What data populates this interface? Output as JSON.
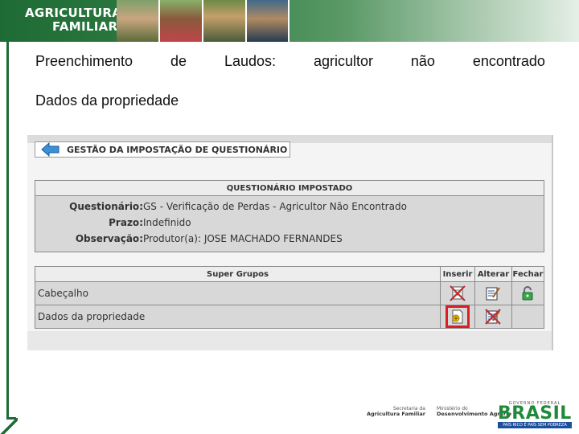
{
  "banner": {
    "title_line1": "AGRICULTURA",
    "title_line2": "FAMILIAR"
  },
  "slide": {
    "heading_words": [
      "Preenchimento",
      "de",
      "Laudos:",
      "agricultor",
      "não",
      "encontrado"
    ],
    "subheading": "Dados da propriedade"
  },
  "screen": {
    "section_title": "GESTÃO DA IMPOSTAÇÃO DE QUESTIONÁRIO",
    "questionnaire": {
      "header": "QUESTIONÁRIO IMPOSTADO",
      "fields": [
        {
          "label": "Questionário",
          "value": "GS - Verificação de Perdas - Agricultor Não Encontrado"
        },
        {
          "label": "Prazo",
          "value": "Indefinido"
        },
        {
          "label": "Observação",
          "value": "Produtor(a): JOSE MACHADO FERNANDES"
        }
      ]
    },
    "super_groups": {
      "columns": [
        "Super Grupos",
        "Inserir",
        "Alterar",
        "Fechar"
      ],
      "rows": [
        {
          "name": "Cabeçalho",
          "inserir": "insert-disabled-icon",
          "alterar": "edit-icon",
          "fechar": "lock-open-icon"
        },
        {
          "name": "Dados da propriedade",
          "inserir": "insert-icon",
          "alterar": "edit-disabled-icon",
          "fechar": null
        }
      ]
    },
    "highlight_color": "#d91f26"
  },
  "footer": {
    "secretaria_line1": "Secretaria da",
    "secretaria_line2": "Agricultura Familiar",
    "ministerio_line1": "Ministério do",
    "ministerio_line2": "Desenvolvimento Agrário",
    "gov_label": "GOVERNO FEDERAL",
    "brasil": "BRASIL",
    "motto": "PAÍS RICO É PAÍS SEM POBREZA"
  },
  "colors": {
    "brand_green": "#1f6b35",
    "panel_gray": "#d8d8d8",
    "header_gray": "#ededed"
  }
}
